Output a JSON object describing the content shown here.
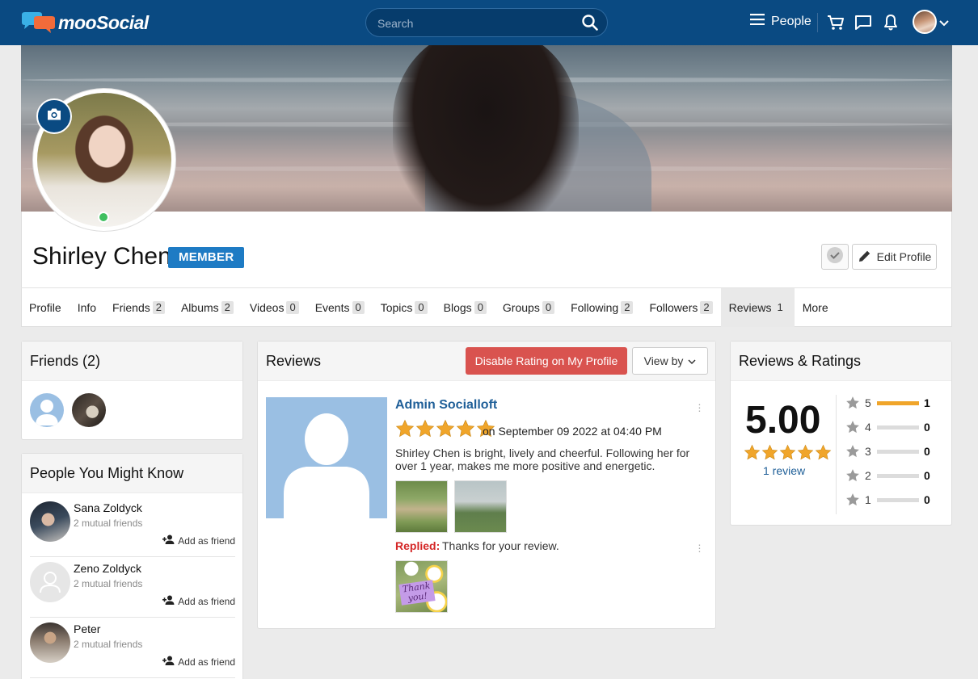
{
  "header": {
    "logo_text": "mooSocial",
    "search_placeholder": "Search",
    "people_label": "People"
  },
  "profile": {
    "name": "Shirley Chen",
    "badge": "MEMBER",
    "edit_label": "Edit Profile"
  },
  "tabs": [
    {
      "label": "Profile",
      "count": ""
    },
    {
      "label": "Info",
      "count": ""
    },
    {
      "label": "Friends",
      "count": "2"
    },
    {
      "label": "Albums",
      "count": "2"
    },
    {
      "label": "Videos",
      "count": "0"
    },
    {
      "label": "Events",
      "count": "0"
    },
    {
      "label": "Topics",
      "count": "0"
    },
    {
      "label": "Blogs",
      "count": "0"
    },
    {
      "label": "Groups",
      "count": "0"
    },
    {
      "label": "Following",
      "count": "2"
    },
    {
      "label": "Followers",
      "count": "2"
    },
    {
      "label": "Reviews",
      "count": "1"
    },
    {
      "label": "More",
      "count": ""
    }
  ],
  "friends_panel": {
    "title": "Friends (2)"
  },
  "pymk_panel": {
    "title": "People You Might Know",
    "items": [
      {
        "name": "Sana Zoldyck",
        "mutual": "2 mutual friends",
        "action": "Add as friend"
      },
      {
        "name": "Zeno Zoldyck",
        "mutual": "2 mutual friends",
        "action": "Add as friend"
      },
      {
        "name": "Peter",
        "mutual": "2 mutual friends",
        "action": "Add as friend"
      }
    ]
  },
  "reviews_panel": {
    "title": "Reviews",
    "disable_label": "Disable Rating on My Profile",
    "viewby_label": "View by",
    "review": {
      "author": "Admin Socialloft",
      "rating": 5,
      "date": "on September 09 2022 at 04:40 PM",
      "text": "Shirley Chen is bright, lively and cheerful. Following her for over 1 year, makes me more positive and energetic.",
      "replied_label": "Replied:",
      "reply_text": "Thanks for your review.",
      "reply_image_text": "Thank you!"
    }
  },
  "ratings_panel": {
    "title": "Reviews & Ratings",
    "score": "5.00",
    "review_count": "1 review",
    "rows": [
      {
        "level": "5",
        "count": "1",
        "fraction": 1.0
      },
      {
        "level": "4",
        "count": "0",
        "fraction": 0
      },
      {
        "level": "3",
        "count": "0",
        "fraction": 0
      },
      {
        "level": "2",
        "count": "0",
        "fraction": 0
      },
      {
        "level": "1",
        "count": "0",
        "fraction": 0
      }
    ]
  },
  "colors": {
    "brand_blue": "#0a4a82",
    "danger": "#d9534f",
    "star": "#f0a52a",
    "badge": "#1e7bc4"
  }
}
